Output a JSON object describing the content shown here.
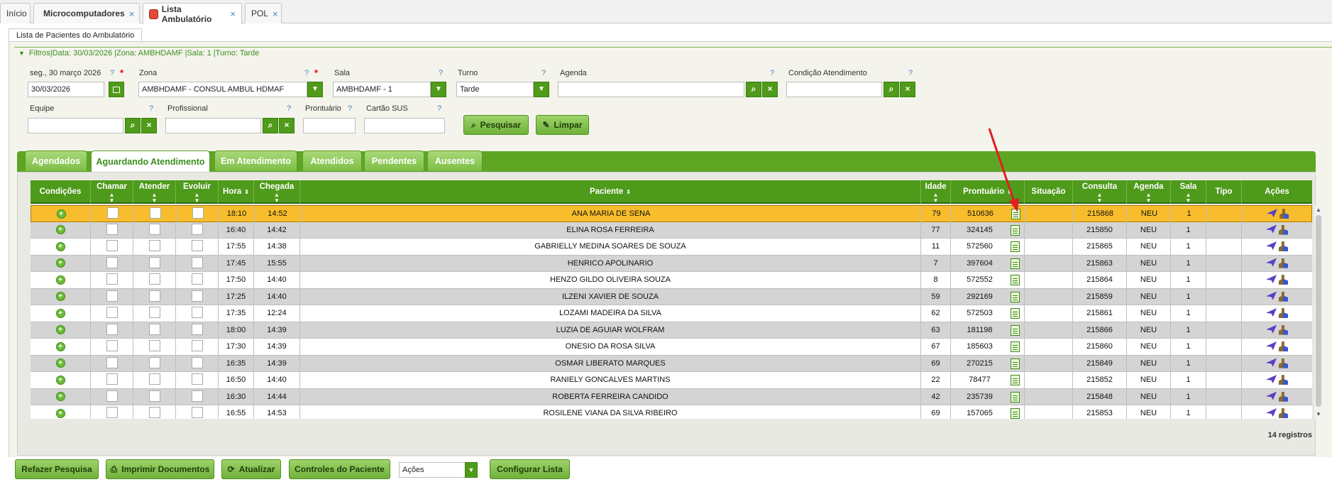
{
  "top_tabs": [
    {
      "label": "Início",
      "closable": false
    },
    {
      "label": "Microcomputadores",
      "closable": true
    },
    {
      "label": "Lista Ambulatório",
      "closable": true
    },
    {
      "label": "POL",
      "closable": true
    }
  ],
  "close_glyph": "×",
  "panel_title": "Lista de Pacientes do Ambulatório",
  "filter_summary": "Filtros|Data: 30/03/2026 |Zona: AMBHDAMF |Sala: 1 |Turno: Tarde",
  "filters": {
    "date_label": "seg., 30 março 2026",
    "date_value": "30/03/2026",
    "zona_label": "Zona",
    "zona_value": "AMBHDAMF - CONSUL AMBUL HDMAF",
    "sala_label": "Sala",
    "sala_value": "AMBHDAMF - 1",
    "turno_label": "Turno",
    "turno_value": "Tarde",
    "agenda_label": "Agenda",
    "agenda_value": "",
    "condicao_label": "Condição Atendimento",
    "condicao_value": "",
    "equipe_label": "Equipe",
    "equipe_value": "",
    "profissional_label": "Profissional",
    "profissional_value": "",
    "prontuario_label": "Prontuário",
    "prontuario_value": "",
    "cartao_label": "Cartão SUS",
    "cartao_value": "",
    "help_glyph": "?",
    "required_glyph": "*",
    "pesquisar_label": "Pesquisar",
    "limpar_label": "Limpar"
  },
  "section_tabs": [
    {
      "label": "Agendados",
      "active": false
    },
    {
      "label": "Aguardando Atendimento",
      "active": true
    },
    {
      "label": "Em Atendimento",
      "active": false
    },
    {
      "label": "Atendidos",
      "active": false
    },
    {
      "label": "Pendentes",
      "active": false
    },
    {
      "label": "Ausentes",
      "active": false
    }
  ],
  "columns": {
    "condicoes": "Condições",
    "chamar": "Chamar",
    "atender": "Atender",
    "evoluir": "Evoluir",
    "hora": "Hora",
    "chegada": "Chegada",
    "paciente": "Paciente",
    "idade": "Idade",
    "prontuario": "Prontuário",
    "situacao": "Situação",
    "consulta": "Consulta",
    "agenda": "Agenda",
    "sala": "Sala",
    "tipo": "Tipo",
    "acoes": "Ações"
  },
  "rows": [
    {
      "hora": "18:10",
      "chegada": "14:52",
      "paciente": "ANA MARIA DE SENA",
      "idade": "79",
      "prontuario": "510636",
      "situacao": "",
      "consulta": "215868",
      "agenda": "NEU",
      "sala": "1",
      "tipo": "",
      "selected": true
    },
    {
      "hora": "16:40",
      "chegada": "14:42",
      "paciente": "ELINA ROSA FERREIRA",
      "idade": "77",
      "prontuario": "324145",
      "situacao": "",
      "consulta": "215850",
      "agenda": "NEU",
      "sala": "1",
      "tipo": ""
    },
    {
      "hora": "17:55",
      "chegada": "14:38",
      "paciente": "GABRIELLY MEDINA SOARES DE SOUZA",
      "idade": "11",
      "prontuario": "572560",
      "situacao": "",
      "consulta": "215865",
      "agenda": "NEU",
      "sala": "1",
      "tipo": ""
    },
    {
      "hora": "17:45",
      "chegada": "15:55",
      "paciente": "HENRICO APOLINARIO",
      "idade": "7",
      "prontuario": "397604",
      "situacao": "",
      "consulta": "215863",
      "agenda": "NEU",
      "sala": "1",
      "tipo": ""
    },
    {
      "hora": "17:50",
      "chegada": "14:40",
      "paciente": "HENZO GILDO OLIVEIRA SOUZA",
      "idade": "8",
      "prontuario": "572552",
      "situacao": "",
      "consulta": "215864",
      "agenda": "NEU",
      "sala": "1",
      "tipo": ""
    },
    {
      "hora": "17:25",
      "chegada": "14:40",
      "paciente": "ILZENI XAVIER DE SOUZA",
      "idade": "59",
      "prontuario": "292169",
      "situacao": "",
      "consulta": "215859",
      "agenda": "NEU",
      "sala": "1",
      "tipo": ""
    },
    {
      "hora": "17:35",
      "chegada": "12:24",
      "paciente": "LOZAMI MADEIRA DA SILVA",
      "idade": "62",
      "prontuario": "572503",
      "situacao": "",
      "consulta": "215861",
      "agenda": "NEU",
      "sala": "1",
      "tipo": ""
    },
    {
      "hora": "18:00",
      "chegada": "14:39",
      "paciente": "LUZIA DE AGUIAR WOLFRAM",
      "idade": "63",
      "prontuario": "181198",
      "situacao": "",
      "consulta": "215866",
      "agenda": "NEU",
      "sala": "1",
      "tipo": ""
    },
    {
      "hora": "17:30",
      "chegada": "14:39",
      "paciente": "ONESIO DA ROSA SILVA",
      "idade": "67",
      "prontuario": "185603",
      "situacao": "",
      "consulta": "215860",
      "agenda": "NEU",
      "sala": "1",
      "tipo": ""
    },
    {
      "hora": "16:35",
      "chegada": "14:39",
      "paciente": "OSMAR LIBERATO MARQUES",
      "idade": "69",
      "prontuario": "270215",
      "situacao": "",
      "consulta": "215849",
      "agenda": "NEU",
      "sala": "1",
      "tipo": ""
    },
    {
      "hora": "16:50",
      "chegada": "14:40",
      "paciente": "RANIELY GONCALVES MARTINS",
      "idade": "22",
      "prontuario": "78477",
      "situacao": "",
      "consulta": "215852",
      "agenda": "NEU",
      "sala": "1",
      "tipo": ""
    },
    {
      "hora": "16:30",
      "chegada": "14:44",
      "paciente": "ROBERTA FERREIRA CANDIDO",
      "idade": "42",
      "prontuario": "235739",
      "situacao": "",
      "consulta": "215848",
      "agenda": "NEU",
      "sala": "1",
      "tipo": ""
    },
    {
      "hora": "16:55",
      "chegada": "14:53",
      "paciente": "ROSILENE VIANA DA SILVA RIBEIRO",
      "idade": "69",
      "prontuario": "157065",
      "situacao": "",
      "consulta": "215853",
      "agenda": "NEU",
      "sala": "1",
      "tipo": ""
    }
  ],
  "records_count": "14 registros",
  "bottom": {
    "refazer": "Refazer Pesquisa",
    "imprimir": "Imprimir Documentos",
    "atualizar": "Atualizar",
    "controles": "Controles do Paciente",
    "acoes_select": "Ações",
    "configurar": "Configurar Lista"
  },
  "colors": {
    "green": "#4e9a1b",
    "selected_row": "#f7bd2c",
    "annotation_arrow": "#e21f1f"
  }
}
